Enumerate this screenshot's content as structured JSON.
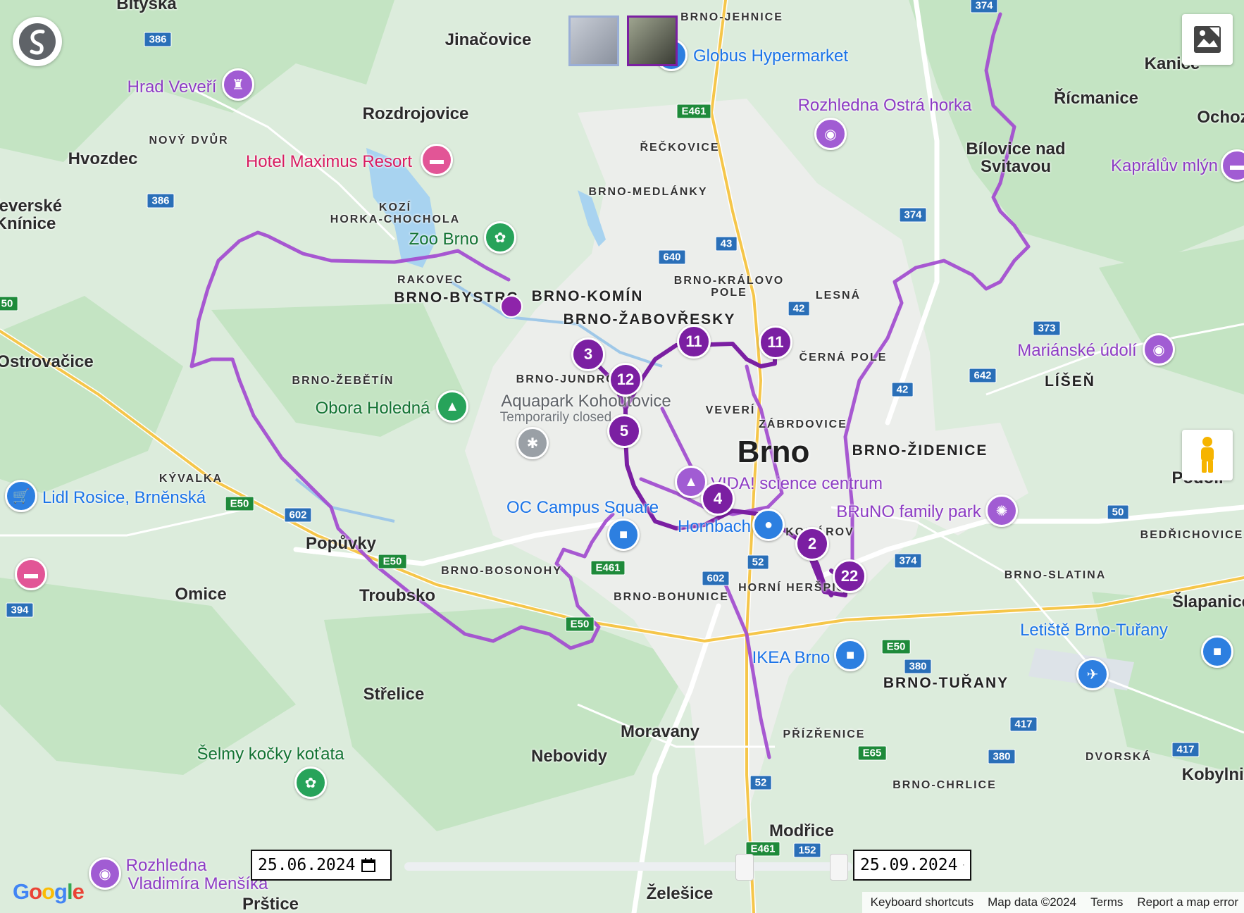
{
  "map": {
    "city_label": "Brno",
    "towns": [
      {
        "id": "bityska",
        "name": "Bitýška"
      },
      {
        "id": "jinacovice",
        "name": "Jinačovice"
      },
      {
        "id": "rozdrojovice",
        "name": "Rozdrojovice"
      },
      {
        "id": "hvozdec",
        "name": "Hvozdec"
      },
      {
        "id": "veverske",
        "name": "Veverské"
      },
      {
        "id": "kninice",
        "name": "Knínice"
      },
      {
        "id": "ostrovacice",
        "name": "Ostrovačice"
      },
      {
        "id": "popuvky",
        "name": "Popůvky"
      },
      {
        "id": "troubsko",
        "name": "Troubsko"
      },
      {
        "id": "omice",
        "name": "Omice"
      },
      {
        "id": "strelice",
        "name": "Střelice"
      },
      {
        "id": "moravany",
        "name": "Moravany"
      },
      {
        "id": "nebovidy",
        "name": "Nebovidy"
      },
      {
        "id": "modrice",
        "name": "Modřice"
      },
      {
        "id": "zelesice",
        "name": "Želešice"
      },
      {
        "id": "prstice",
        "name": "Prštice"
      },
      {
        "id": "kanice",
        "name": "Kanice"
      },
      {
        "id": "ricmanice",
        "name": "Řícmanice"
      },
      {
        "id": "ochoz",
        "name": "Ochoz"
      },
      {
        "id": "bilovice1",
        "name": "Bílovice nad"
      },
      {
        "id": "bilovice2",
        "name": "Svitavou"
      },
      {
        "id": "slapanice",
        "name": "Šlapanice"
      },
      {
        "id": "podoli",
        "name": "Podolí"
      },
      {
        "id": "kobyli",
        "name": "Kobylnice"
      }
    ],
    "districts": [
      {
        "id": "jehnice",
        "name": "BRNO-JEHNICE"
      },
      {
        "id": "novydvur",
        "name": "NOVÝ DVŮR"
      },
      {
        "id": "reckovice",
        "name": "ŘEČKOVICE"
      },
      {
        "id": "medlanky",
        "name": "BRNO-MEDLÁNKY"
      },
      {
        "id": "kozi1",
        "name": "KOZÍ"
      },
      {
        "id": "kozi2",
        "name": "HORKA-CHOCHOLA"
      },
      {
        "id": "rakovec",
        "name": "RAKOVEC"
      },
      {
        "id": "bystrc",
        "name": "BRNO-BYSTRC"
      },
      {
        "id": "komin",
        "name": "BRNO-KOMÍN"
      },
      {
        "id": "kpole1",
        "name": "BRNO-KRÁLOVO"
      },
      {
        "id": "kpole2",
        "name": "POLE"
      },
      {
        "id": "lesna",
        "name": "LESNÁ"
      },
      {
        "id": "zabovresky",
        "name": "BRNO-ŽABOVŘESKY"
      },
      {
        "id": "cernapole",
        "name": "ČERNÁ POLE"
      },
      {
        "id": "zebetin",
        "name": "BRNO-ŽEBĚTÍN"
      },
      {
        "id": "jundrov",
        "name": "BRNO-JUNDROV"
      },
      {
        "id": "veveri",
        "name": "VEVERÍ"
      },
      {
        "id": "zabrdovice",
        "name": "ZÁBRDOVICE"
      },
      {
        "id": "zidenice",
        "name": "BRNO-ŽIDENICE"
      },
      {
        "id": "lisen",
        "name": "LÍŠEŇ"
      },
      {
        "id": "kyvalka",
        "name": "KÝVALKA"
      },
      {
        "id": "bosonohy",
        "name": "BRNO-BOSONOHY"
      },
      {
        "id": "bohunice",
        "name": "BRNO-BOHUNICE"
      },
      {
        "id": "komarov",
        "name": "KOMÁROV"
      },
      {
        "id": "hornihe",
        "name": "HORNÍ HERŠPICE"
      },
      {
        "id": "bedrichovice",
        "name": "BEDŘICHOVICE"
      },
      {
        "id": "slatina",
        "name": "BRNO-SLATINA"
      },
      {
        "id": "turany",
        "name": "BRNO-TUŘANY"
      },
      {
        "id": "prizrenice",
        "name": "PŘÍZŘENICE"
      },
      {
        "id": "dvorska",
        "name": "DVORSKÁ"
      },
      {
        "id": "chrlice",
        "name": "BRNO-CHRLICE"
      }
    ],
    "pois": [
      {
        "id": "hradveveri",
        "name": "Hrad Veveří",
        "style": "purple",
        "icon": "castle-icon",
        "glyph": "♜"
      },
      {
        "id": "maximus",
        "name": "Hotel Maximus Resort",
        "style": "pink",
        "icon": "hotel-icon",
        "glyph": "▬"
      },
      {
        "id": "zoo",
        "name": "Zoo Brno",
        "style": "green",
        "icon": "paw-icon",
        "glyph": "✿"
      },
      {
        "id": "globus",
        "name": "Globus Hypermarket",
        "style": "blue",
        "icon": "cart-icon",
        "glyph": "●"
      },
      {
        "id": "ostrahorka",
        "name": "Rozhledna Ostrá horka",
        "style": "purple",
        "icon": "camera-icon",
        "glyph": "◉"
      },
      {
        "id": "kapraluv",
        "name": "Kaprálův mlýn",
        "style": "purple",
        "icon": "hotel-icon",
        "glyph": "▬"
      },
      {
        "id": "marianske",
        "name": "Mariánské údolí",
        "style": "purple",
        "icon": "camera-icon",
        "glyph": "◉"
      },
      {
        "id": "holedna",
        "name": "Obora Holedná",
        "style": "green",
        "icon": "tree-icon",
        "glyph": "▲"
      },
      {
        "id": "aquapark",
        "name": "Aquapark Kohoutovice",
        "style": "gray",
        "icon": "gear-icon",
        "glyph": "✱"
      },
      {
        "id": "lidl",
        "name": "Lidl Rosice, Brněnská",
        "style": "blue",
        "icon": "cart-icon",
        "glyph": "🛒"
      },
      {
        "id": "vida",
        "name": "VIDA! science centrum",
        "style": "purple",
        "icon": "museum-icon",
        "glyph": "▲"
      },
      {
        "id": "campus",
        "name": "OC Campus Square",
        "style": "blue",
        "icon": "shopping-bag-icon",
        "glyph": "■"
      },
      {
        "id": "hornbach",
        "name": "Hornbach",
        "style": "blue",
        "icon": "store-icon",
        "glyph": "●"
      },
      {
        "id": "bruno",
        "name": "BRuNO family park",
        "style": "purple",
        "icon": "park-icon",
        "glyph": "✺"
      },
      {
        "id": "letiste",
        "name": "Letiště Brno-Tuřany",
        "style": "blue",
        "icon": "airport-icon",
        "glyph": "✈"
      },
      {
        "id": "ikea",
        "name": "IKEA Brno",
        "style": "blue",
        "icon": "shopping-bag-icon",
        "glyph": "■"
      },
      {
        "id": "selmy",
        "name": "Šelmy kočky koťata",
        "style": "green",
        "icon": "paw-icon",
        "glyph": "✿"
      },
      {
        "id": "rozhmen1",
        "name": "Rozhledna",
        "style": "purple",
        "icon": "camera-icon",
        "glyph": "◉"
      },
      {
        "id": "rozhmen2",
        "name": "Vladimíra Menšíka",
        "style": "purple",
        "icon": "",
        "glyph": ""
      },
      {
        "id": "hotelleft",
        "name": "",
        "style": "pink",
        "icon": "hotel-icon",
        "glyph": "▬"
      },
      {
        "id": "leftbag",
        "name": "",
        "style": "blue",
        "icon": "shopping-bag-icon",
        "glyph": "■"
      }
    ],
    "poi_sublabels": [
      {
        "id": "aquapark_status",
        "text": "Temporarily closed"
      }
    ],
    "road_shields": [
      {
        "id": "r386a",
        "text": "386",
        "type": "road"
      },
      {
        "id": "r386b",
        "text": "386",
        "type": "road"
      },
      {
        "id": "re461a",
        "text": "E461",
        "type": "euro"
      },
      {
        "id": "r640",
        "text": "640",
        "type": "road"
      },
      {
        "id": "r43",
        "text": "43",
        "type": "road"
      },
      {
        "id": "r42a",
        "text": "42",
        "type": "road"
      },
      {
        "id": "r42b",
        "text": "42",
        "type": "road"
      },
      {
        "id": "r374a",
        "text": "374",
        "type": "road"
      },
      {
        "id": "r373",
        "text": "373",
        "type": "road"
      },
      {
        "id": "r642",
        "text": "642",
        "type": "road"
      },
      {
        "id": "re50a",
        "text": "E50",
        "type": "euro"
      },
      {
        "id": "r602a",
        "text": "602",
        "type": "road"
      },
      {
        "id": "re50b",
        "text": "E50",
        "type": "euro"
      },
      {
        "id": "re461b",
        "text": "E461",
        "type": "euro"
      },
      {
        "id": "r602b",
        "text": "602",
        "type": "road"
      },
      {
        "id": "r52a",
        "text": "52",
        "type": "road"
      },
      {
        "id": "r374b",
        "text": "374",
        "type": "road"
      },
      {
        "id": "r50",
        "text": "50",
        "type": "road"
      },
      {
        "id": "re50c",
        "text": "E50",
        "type": "euro"
      },
      {
        "id": "re50d",
        "text": "E50",
        "type": "euro"
      },
      {
        "id": "r380a",
        "text": "380",
        "type": "road"
      },
      {
        "id": "r417a",
        "text": "417",
        "type": "road"
      },
      {
        "id": "r380b",
        "text": "380",
        "type": "road"
      },
      {
        "id": "r417b",
        "text": "417",
        "type": "road"
      },
      {
        "id": "re65",
        "text": "E65",
        "type": "euro"
      },
      {
        "id": "r52b",
        "text": "52",
        "type": "road"
      },
      {
        "id": "re461c",
        "text": "E461",
        "type": "euro"
      },
      {
        "id": "r152",
        "text": "152",
        "type": "road"
      },
      {
        "id": "r394",
        "text": "394",
        "type": "road"
      },
      {
        "id": "r50left",
        "text": "50",
        "type": "euro"
      },
      {
        "id": "r374top",
        "text": "374",
        "type": "road"
      }
    ],
    "clusters": [
      {
        "id": "c3",
        "count": "3"
      },
      {
        "id": "c12",
        "count": "12"
      },
      {
        "id": "c11a",
        "count": "11"
      },
      {
        "id": "c11b",
        "count": "11"
      },
      {
        "id": "c5",
        "count": "5"
      },
      {
        "id": "c4",
        "count": "4"
      },
      {
        "id": "c2",
        "count": "2"
      },
      {
        "id": "c22",
        "count": "22"
      }
    ]
  },
  "photo_strip": [
    {
      "id": "photo1",
      "alt": "Photo thumbnail 1",
      "selected": false
    },
    {
      "id": "photo2",
      "alt": "Photo thumbnail 2",
      "selected": true
    }
  ],
  "controls": {
    "fullscreen_icon": "image-icon",
    "pegman_icon": "pegman-icon",
    "app_logo_icon": "app-logo-icon"
  },
  "date_range": {
    "start": "25.06.2024",
    "end": "25.09.2024",
    "calendar_icon": "calendar-icon"
  },
  "footer": {
    "google": "Google",
    "keyboard": "Keyboard shortcuts",
    "mapdata": "Map data ©2024",
    "terms": "Terms",
    "report": "Report a map error"
  },
  "colors": {
    "track": "#9c47c4",
    "track_dark": "#7b1fa2",
    "cluster": "#7b1fa2",
    "road_shield": "#2a6fb8",
    "euro_shield": "#1e8a3a",
    "water": "#a8d3f0",
    "forest": "#c7e6c5",
    "urban": "#eef0ee"
  }
}
